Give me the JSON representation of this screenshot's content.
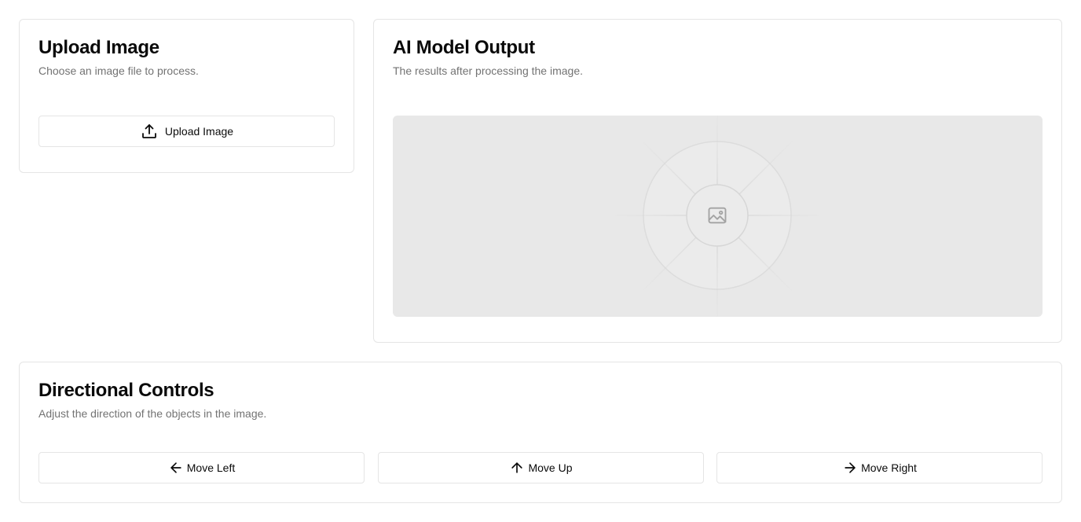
{
  "upload": {
    "title": "Upload Image",
    "description": "Choose an image file to process.",
    "button_label": "Upload Image",
    "button_icon": "upload-icon"
  },
  "output": {
    "title": "AI Model Output",
    "description": "The results after processing the image.",
    "placeholder_icon": "image-icon"
  },
  "controls": {
    "title": "Directional Controls",
    "description": "Adjust the direction of the objects in the image.",
    "buttons": [
      {
        "label": "Move Left",
        "icon": "arrow-left-icon"
      },
      {
        "label": "Move Up",
        "icon": "arrow-up-icon"
      },
      {
        "label": "Move Right",
        "icon": "arrow-right-icon"
      }
    ]
  },
  "colors": {
    "border": "#e5e5e5",
    "muted_text": "#737373",
    "placeholder_bg": "#e8e8e8"
  }
}
